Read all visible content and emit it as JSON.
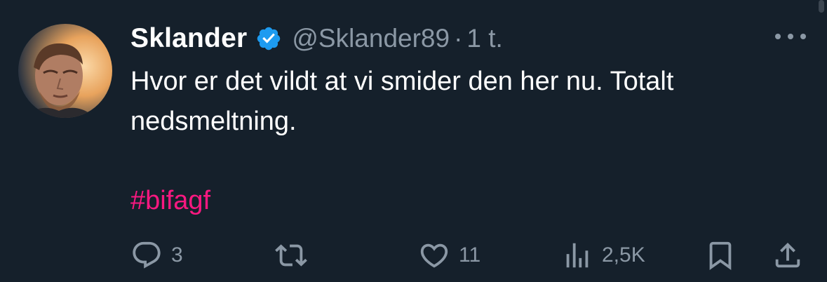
{
  "tweet": {
    "author_name": "Sklander",
    "handle": "@Sklander89",
    "separator": "·",
    "time": "1 t.",
    "text": "Hvor er det vildt at vi smider den her nu. Totalt nedsmeltning.",
    "hashtag": "#bifagf",
    "verified": true,
    "avatar_icon": "profile-photo"
  },
  "actions": {
    "replies": "3",
    "retweets": "",
    "likes": "11",
    "views": "2,5K"
  },
  "colors": {
    "background": "#15202b",
    "secondary_text": "#8b98a5",
    "verified_blue": "#1d9bf0",
    "hashtag": "#f91880"
  },
  "icons": [
    "more-icon",
    "reply-icon",
    "retweet-icon",
    "like-icon",
    "views-icon",
    "bookmark-icon",
    "share-icon",
    "verified-badge-icon"
  ]
}
